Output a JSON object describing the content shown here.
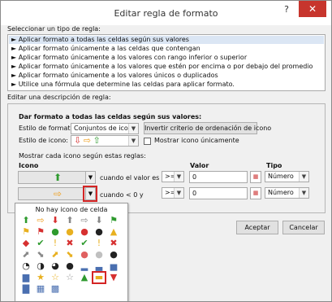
{
  "title": "Editar regla de formato",
  "help_label": "?",
  "close_label": "✕",
  "select_rule_type_label": "Seleccionar un tipo de regla:",
  "rule_types": [
    {
      "label": "► Aplicar formato a todas las celdas según sus valores",
      "selected": true
    },
    {
      "label": "► Aplicar formato únicamente a las celdas que contengan",
      "selected": false
    },
    {
      "label": "► Aplicar formato únicamente a los valores con rango inferior o superior",
      "selected": false
    },
    {
      "label": "► Aplicar formato únicamente a los valores que estén por encima o por debajo del promedio",
      "selected": false
    },
    {
      "label": "► Aplicar formato únicamente a los valores únicos o duplicados",
      "selected": false
    },
    {
      "label": "► Utilice una fórmula que determine las celdas para aplicar formato.",
      "selected": false
    }
  ],
  "edit_description_label": "Editar una descripción de regla:",
  "format_all_label": "Dar formato a todas las celdas según sus valores:",
  "format_style_label": "Estilo de formato:",
  "format_style_value": "Conjuntos de iconos",
  "reverse_icon_order_label": "Invertir criterio de ordenación de icono",
  "icon_style_label": "Estilo de icono:",
  "icon_style_preview": [
    "⇩",
    "⇨",
    "⇧"
  ],
  "show_icon_only_label": "Mostrar icono únicamente",
  "show_icon_only_checked": false,
  "show_each_icon_label": "Mostrar cada icono según estas reglas:",
  "column_headers": {
    "icon": "Icono",
    "value": "Valor",
    "type": "Tipo"
  },
  "rules": [
    {
      "icon": "⬆",
      "icon_color": "#2e9a2e",
      "condition": "cuando el valor es",
      "operator": ">=",
      "value": "0",
      "type": "Número"
    },
    {
      "icon": "⇨",
      "icon_color": "#f0a020",
      "condition": "cuando < 0 y",
      "operator": ">=",
      "value": "0",
      "type": "Número"
    }
  ],
  "popup": {
    "no_icon_label": "No hay icono de celda",
    "icons": [
      {
        "g": "⬆",
        "c": "#2e9a2e"
      },
      {
        "g": "⇨",
        "c": "#f0a020"
      },
      {
        "g": "⬇",
        "c": "#d63030"
      },
      {
        "g": "⬆",
        "c": "#888888"
      },
      {
        "g": "⇨",
        "c": "#888888"
      },
      {
        "g": "⬇",
        "c": "#888888"
      },
      {
        "g": "⚑",
        "c": "#2e9a2e"
      },
      {
        "g": "⚑",
        "c": "#e8b020"
      },
      {
        "g": "⚑",
        "c": "#d63030"
      },
      {
        "g": "●",
        "c": "#2e9a2e"
      },
      {
        "g": "●",
        "c": "#e8b020"
      },
      {
        "g": "●",
        "c": "#d63030"
      },
      {
        "g": "●",
        "c": "#222222"
      },
      {
        "g": "▲",
        "c": "#e8b020"
      },
      {
        "g": "◆",
        "c": "#d63030"
      },
      {
        "g": "✔",
        "c": "#2e9a2e"
      },
      {
        "g": "!",
        "c": "#e8b020"
      },
      {
        "g": "✖",
        "c": "#d63030"
      },
      {
        "g": "✔",
        "c": "#2e9a2e"
      },
      {
        "g": "!",
        "c": "#e8b020"
      },
      {
        "g": "✖",
        "c": "#d63030"
      },
      {
        "g": "⬈",
        "c": "#888888"
      },
      {
        "g": "⬊",
        "c": "#888888"
      },
      {
        "g": "⬈",
        "c": "#e8b020"
      },
      {
        "g": "⬊",
        "c": "#e8b020"
      },
      {
        "g": "●",
        "c": "#e06060"
      },
      {
        "g": "●",
        "c": "#c0c0c0"
      },
      {
        "g": "●",
        "c": "#222222"
      },
      {
        "g": "◔",
        "c": "#222222"
      },
      {
        "g": "◑",
        "c": "#222222"
      },
      {
        "g": "◕",
        "c": "#222222"
      },
      {
        "g": "●",
        "c": "#222222"
      },
      {
        "g": "▂",
        "c": "#4a6fb0"
      },
      {
        "g": "▃",
        "c": "#4a6fb0"
      },
      {
        "g": "▅",
        "c": "#4a6fb0"
      },
      {
        "g": "▆",
        "c": "#4a6fb0"
      },
      {
        "g": "★",
        "c": "#e8b020"
      },
      {
        "g": "☆",
        "c": "#e8b020"
      },
      {
        "g": "☆",
        "c": "#999999"
      },
      {
        "g": "▲",
        "c": "#2e9a2e"
      },
      {
        "g": "▬",
        "c": "#e8b020"
      },
      {
        "g": "▼",
        "c": "#d63030"
      },
      {
        "g": "▇",
        "c": "#4a6fb0"
      },
      {
        "g": "▦",
        "c": "#4a6fb0"
      },
      {
        "g": "▩",
        "c": "#4a6fb0"
      }
    ],
    "selected_index": 40
  },
  "ok_label": "Aceptar",
  "cancel_label": "Cancelar"
}
